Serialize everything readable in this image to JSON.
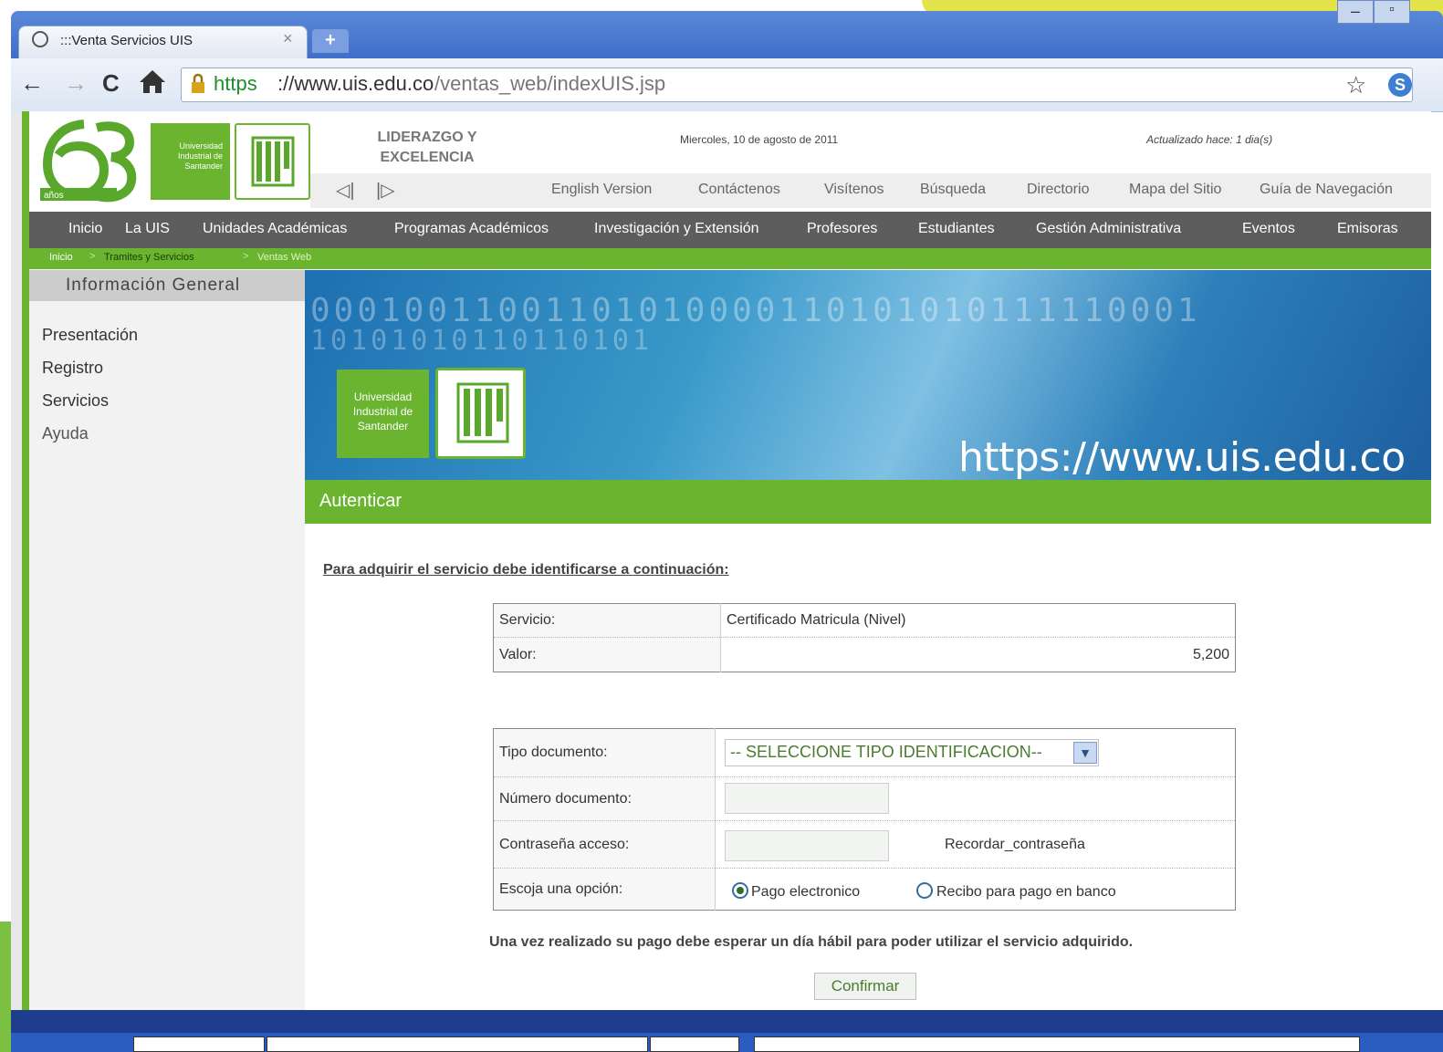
{
  "browser": {
    "tab_title": ":::Venta Servicios UIS",
    "tab_close": "×",
    "new_tab": "+",
    "url_scheme": "https",
    "url_host": "://www.uis.edu.co",
    "url_path": "/ventas_web/indexUIS.jsp",
    "window_minimize": "–",
    "window_maximize": "▫"
  },
  "header": {
    "logo_anos": "años",
    "logo_green_text": "Universidad Industrial de Santander",
    "lema_line1": "LIDERAZGO Y",
    "lema_line2": "EXCELENCIA",
    "fecha": "Miercoles, 10 de agosto de 2011",
    "actualizado": "Actualizado hace: 1 dia(s)",
    "links": [
      "English Version",
      "Contáctenos",
      "Visítenos",
      "Búsqueda",
      "Directorio",
      "Mapa del Sitio",
      "Guía de Navegación"
    ]
  },
  "main_menu": [
    "Inicio",
    "La UIS",
    "Unidades Académicas",
    "Programas Académicos",
    "Investigación y Extensión",
    "Profesores",
    "Estudiantes",
    "Gestión Administrativa",
    "Eventos",
    "Emisoras"
  ],
  "breadcrumb": [
    "Inicio",
    "Tramites y Servicios",
    "Ventas Web"
  ],
  "sidebar": {
    "title": "Información General",
    "items": [
      "Presentación",
      "Registro",
      "Servicios",
      "Ayuda"
    ]
  },
  "banner": {
    "bits_line1": "00010011001101010000110101010111110001",
    "bits_line2": "10101010110110101",
    "logo_text_line1": "Universidad",
    "logo_text_line2": "Industrial de",
    "logo_text_line3": "Santander",
    "url": "https://www.uis.edu.co"
  },
  "auth": {
    "title": "Autenticar",
    "instructions": "Para adquirir el servicio debe identificarse a continuación:",
    "service_label": "Servicio:",
    "service_value": "Certificado Matricula (Nivel)",
    "value_label": "Valor:",
    "value_amount": "5,200",
    "doc_type_label": "Tipo documento:",
    "doc_type_selected": "-- SELECCIONE TIPO IDENTIFICACION--",
    "doc_number_label": "Número documento:",
    "password_label": "Contraseña acceso:",
    "remember_password": "Recordar_contraseña",
    "option_label": "Escoja una opción:",
    "option_electronic": "Pago electronico",
    "option_bank": "Recibo para pago en banco",
    "notice": "Una vez realizado su pago debe esperar un día hábil para poder utilizar el servicio adquirido.",
    "confirm_label": "Confirmar"
  },
  "colors": {
    "uis_green": "#6ab42f",
    "menu_gray": "#5d5d5d",
    "chrome_blue": "#3f6fc8"
  }
}
